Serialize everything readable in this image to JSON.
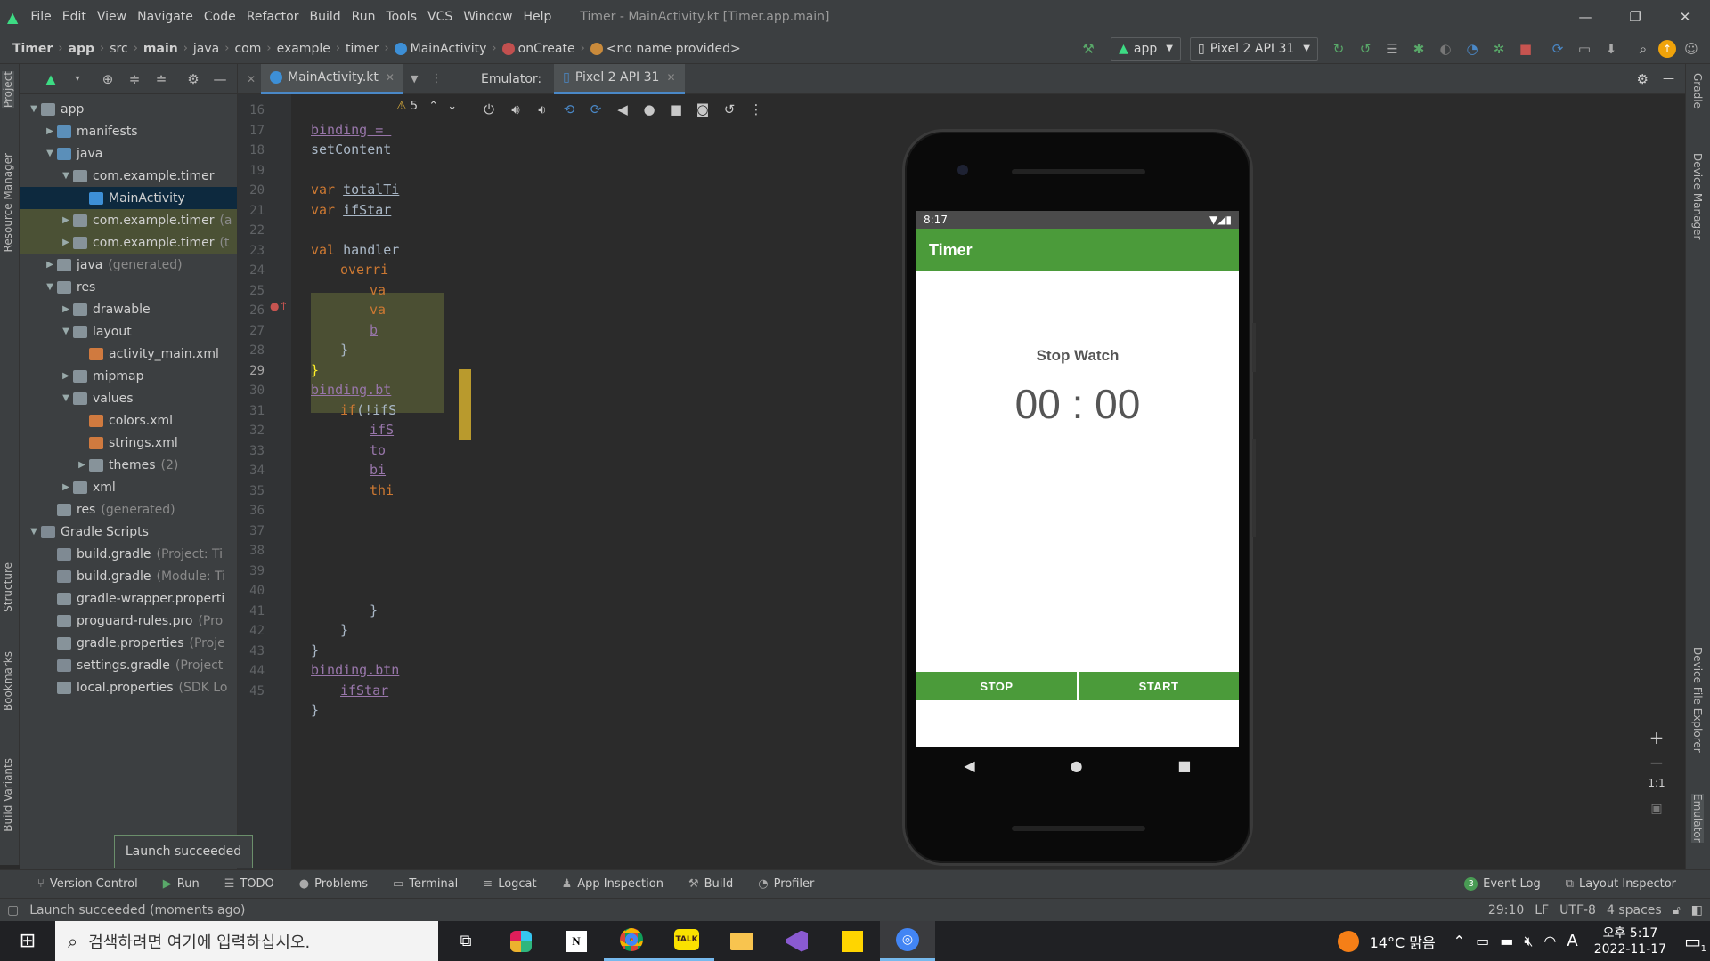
{
  "titlebar": {
    "menu": [
      "File",
      "Edit",
      "View",
      "Navigate",
      "Code",
      "Refactor",
      "Build",
      "Run",
      "Tools",
      "VCS",
      "Window",
      "Help"
    ],
    "title": "Timer - MainActivity.kt [Timer.app.main]"
  },
  "breadcrumbs": [
    "Timer",
    "app",
    "src",
    "main",
    "java",
    "com",
    "example",
    "timer",
    "MainActivity",
    "onCreate",
    "<no name provided>"
  ],
  "run_config": "app",
  "device_selector": "Pixel 2 API 31",
  "project": {
    "tree": [
      {
        "label": "app",
        "indent": 0,
        "arrow": "▼",
        "icon": "folder",
        "bold": true
      },
      {
        "label": "manifests",
        "indent": 1,
        "arrow": "▶",
        "icon": "folder-blue"
      },
      {
        "label": "java",
        "indent": 1,
        "arrow": "▼",
        "icon": "folder-blue"
      },
      {
        "label": "com.example.timer",
        "indent": 2,
        "arrow": "▼",
        "icon": "folder"
      },
      {
        "label": "MainActivity",
        "indent": 3,
        "arrow": "",
        "icon": "ktfile",
        "selected": true
      },
      {
        "label": "com.example.timer",
        "suffix": "(a",
        "indent": 2,
        "arrow": "▶",
        "icon": "folder",
        "highlight": true
      },
      {
        "label": "com.example.timer",
        "suffix": "(t",
        "indent": 2,
        "arrow": "▶",
        "icon": "folder",
        "highlight": true
      },
      {
        "label": "java",
        "suffix": "(generated)",
        "indent": 1,
        "arrow": "▶",
        "icon": "folder"
      },
      {
        "label": "res",
        "indent": 1,
        "arrow": "▼",
        "icon": "folder"
      },
      {
        "label": "drawable",
        "indent": 2,
        "arrow": "▶",
        "icon": "folder"
      },
      {
        "label": "layout",
        "indent": 2,
        "arrow": "▼",
        "icon": "folder"
      },
      {
        "label": "activity_main.xml",
        "indent": 3,
        "arrow": "",
        "icon": "xmlfile"
      },
      {
        "label": "mipmap",
        "indent": 2,
        "arrow": "▶",
        "icon": "folder"
      },
      {
        "label": "values",
        "indent": 2,
        "arrow": "▼",
        "icon": "folder"
      },
      {
        "label": "colors.xml",
        "indent": 3,
        "arrow": "",
        "icon": "xmlfile"
      },
      {
        "label": "strings.xml",
        "indent": 3,
        "arrow": "",
        "icon": "xmlfile"
      },
      {
        "label": "themes",
        "suffix": "(2)",
        "indent": 3,
        "arrow": "▶",
        "icon": "folder"
      },
      {
        "label": "xml",
        "indent": 2,
        "arrow": "▶",
        "icon": "folder"
      },
      {
        "label": "res",
        "suffix": "(generated)",
        "indent": 1,
        "arrow": "",
        "icon": "folder"
      },
      {
        "label": "Gradle Scripts",
        "indent": 0,
        "arrow": "▼",
        "icon": "gradle"
      },
      {
        "label": "build.gradle",
        "suffix": "(Project: Ti",
        "indent": 1,
        "arrow": "",
        "icon": "gradle"
      },
      {
        "label": "build.gradle",
        "suffix": "(Module: Ti",
        "indent": 1,
        "arrow": "",
        "icon": "gradle"
      },
      {
        "label": "gradle-wrapper.properti",
        "indent": 1,
        "arrow": "",
        "icon": "folder"
      },
      {
        "label": "proguard-rules.pro",
        "suffix": "(Pro",
        "indent": 1,
        "arrow": "",
        "icon": "folder"
      },
      {
        "label": "gradle.properties",
        "suffix": "(Proje",
        "indent": 1,
        "arrow": "",
        "icon": "folder"
      },
      {
        "label": "settings.gradle",
        "suffix": "(Project",
        "indent": 1,
        "arrow": "",
        "icon": "gradle"
      },
      {
        "label": "local.properties",
        "suffix": "(SDK Lo",
        "indent": 1,
        "arrow": "",
        "icon": "folder"
      }
    ]
  },
  "editor": {
    "tab": "MainActivity.kt",
    "warnings": "5",
    "line_numbers": [
      "16",
      "17",
      "18",
      "19",
      "20",
      "21",
      "22",
      "23",
      "24",
      "25",
      "26",
      "27",
      "28",
      "29",
      "30",
      "31",
      "32",
      "33",
      "34",
      "35",
      "36",
      "37",
      "38",
      "39",
      "40",
      "41",
      "42",
      "43",
      "44",
      "45"
    ],
    "lines": [
      {
        "text": "",
        "indent": 0
      },
      {
        "text": "binding = ",
        "indent": 0,
        "style": "u-prop"
      },
      {
        "text": "setContent",
        "indent": 0
      },
      {
        "text": "",
        "indent": 0
      },
      {
        "text": "var totalTi",
        "indent": 0,
        "style": "kw"
      },
      {
        "text": "var ifStar",
        "indent": 0,
        "style": "kw"
      },
      {
        "text": "",
        "indent": 0
      },
      {
        "text": "val handler",
        "indent": 0,
        "style": "kw"
      },
      {
        "text": "overri",
        "indent": 1,
        "style": "kw"
      },
      {
        "text": "va",
        "indent": 2,
        "style": "kw"
      },
      {
        "text": "va",
        "indent": 2,
        "style": "kw"
      },
      {
        "text": "b",
        "indent": 2,
        "style": "u"
      },
      {
        "text": "}",
        "indent": 1
      },
      {
        "text": "}",
        "indent": 0
      },
      {
        "text": "binding.bt",
        "indent": 0,
        "style": "u-prop"
      },
      {
        "text": "if(!ifS",
        "indent": 1,
        "style": "kw"
      },
      {
        "text": "ifS",
        "indent": 2,
        "style": "u"
      },
      {
        "text": "to",
        "indent": 2,
        "style": "u"
      },
      {
        "text": "bi",
        "indent": 2,
        "style": "u"
      },
      {
        "text": "thi",
        "indent": 2,
        "style": "kw"
      },
      {
        "text": "",
        "indent": 0
      },
      {
        "text": "",
        "indent": 0
      },
      {
        "text": "",
        "indent": 0
      },
      {
        "text": "",
        "indent": 0
      },
      {
        "text": "",
        "indent": 0
      },
      {
        "text": "}",
        "indent": 2
      },
      {
        "text": "}",
        "indent": 1
      },
      {
        "text": "}",
        "indent": 0
      },
      {
        "text": "binding.btn",
        "indent": 0,
        "style": "u-prop"
      },
      {
        "text": "ifStar",
        "indent": 1,
        "style": "u"
      }
    ],
    "extra_line": "}"
  },
  "emulator": {
    "label": "Emulator:",
    "tab": "Pixel 2 API 31",
    "zoom_label": "1:1"
  },
  "phone": {
    "time": "8:17",
    "app_title": "Timer",
    "heading": "Stop Watch",
    "timer_display": "00 : 00",
    "stop_button": "STOP",
    "start_button": "START"
  },
  "left_strip": [
    "Project",
    "Resource Manager",
    "Structure",
    "Bookmarks",
    "Build Variants"
  ],
  "right_strip": [
    "Gradle",
    "Device Manager",
    "Device File Explorer",
    "Emulator"
  ],
  "bottom_tools": [
    {
      "label": "Version Control",
      "glyph": "⑂"
    },
    {
      "label": "Run",
      "glyph": "▶"
    },
    {
      "label": "TODO",
      "glyph": "☰"
    },
    {
      "label": "Problems",
      "glyph": "●"
    },
    {
      "label": "Terminal",
      "glyph": "▭"
    },
    {
      "label": "Logcat",
      "glyph": "≡"
    },
    {
      "label": "App Inspection",
      "glyph": "♟"
    },
    {
      "label": "Build",
      "glyph": "⚒"
    },
    {
      "label": "Profiler",
      "glyph": "◔"
    }
  ],
  "event_log": {
    "label": "Event Log",
    "count": "3"
  },
  "layout_inspector": "Layout Inspector",
  "tooltip": "Launch succeeded",
  "status": {
    "message": "Launch succeeded (moments ago)",
    "position": "29:10",
    "line_sep": "LF",
    "encoding": "UTF-8",
    "indent": "4 spaces"
  },
  "taskbar": {
    "search_placeholder": "검색하려면 여기에 입력하십시오.",
    "weather": "14°C 맑음",
    "time": "오후 5:17",
    "date": "2022-11-17",
    "notification_count": "1",
    "ime": "A"
  },
  "colors": {
    "app_green": "#4b9b3a",
    "ide_bg": "#2b2b2b",
    "panel_bg": "#3c3f41"
  }
}
